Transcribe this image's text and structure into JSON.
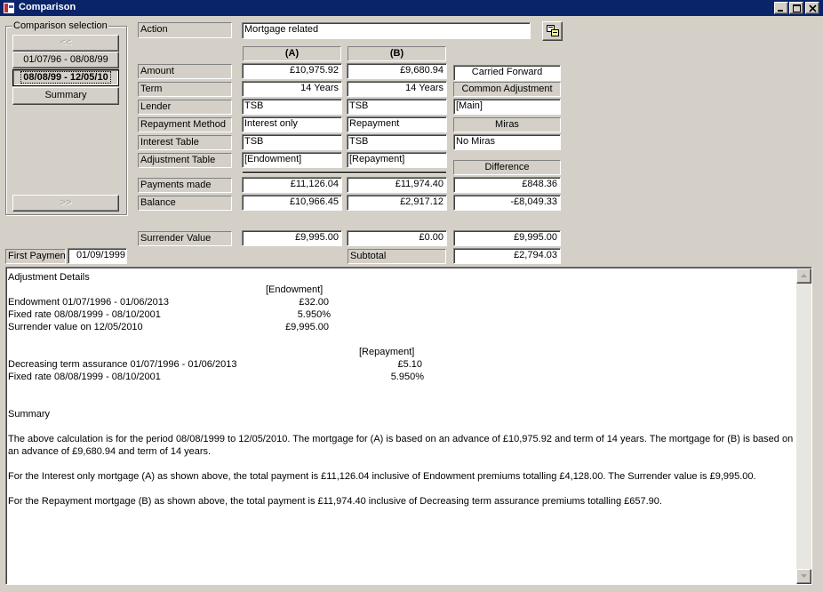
{
  "window": {
    "title": "Comparison"
  },
  "selection": {
    "group_label": "Comparison selection",
    "prev_label": "<<",
    "next_label": ">>",
    "periods": [
      "01/07/96 - 08/08/99",
      "08/08/99 - 12/05/10"
    ],
    "summary_label": "Summary"
  },
  "action": {
    "label": "Action",
    "value": "Mortgage related"
  },
  "columns": {
    "a": "(A)",
    "b": "(B)"
  },
  "rows": [
    {
      "label": "Amount",
      "a": "£10,975.92",
      "b": "£9,680.94"
    },
    {
      "label": "Term",
      "a": "14 Years",
      "b": "14 Years"
    },
    {
      "label": "Lender",
      "a": "TSB",
      "b": "TSB"
    },
    {
      "label": "Repayment Method",
      "a": "Interest only",
      "b": "Repayment"
    },
    {
      "label": "Interest Table",
      "a": "TSB",
      "b": "TSB"
    },
    {
      "label": "Adjustment Table",
      "a": "[Endowment]",
      "b": "[Repayment]"
    }
  ],
  "right_panel": {
    "carried_forward": "Carried Forward",
    "common_adjustment": "Common Adjustment",
    "main_value": "[Main]",
    "miras_label": "Miras",
    "miras_value": "No Miras",
    "difference_label": "Difference"
  },
  "results": [
    {
      "label": "Payments made",
      "a": "£11,126.04",
      "b": "£11,974.40",
      "diff": "£848.36"
    },
    {
      "label": "Balance",
      "a": "£10,966.45",
      "b": "£2,917.12",
      "diff": "-£8,049.33"
    }
  ],
  "surrender": {
    "label": "Surrender Value",
    "a": "£9,995.00",
    "b": "£0.00",
    "diff": "£9,995.00"
  },
  "first_payment": {
    "label": "First Payment",
    "value": "01/09/1999"
  },
  "subtotal": {
    "label": "Subtotal",
    "value": "£2,794.03"
  },
  "details": {
    "heading": "Adjustment Details",
    "endowment_header": "[Endowment]",
    "endowment_rows": [
      {
        "desc": "Endowment 01/07/1996 - 01/06/2013",
        "value": "£32.00"
      },
      {
        "desc": "Fixed rate 08/08/1999 - 08/10/2001",
        "value": "5.950%"
      },
      {
        "desc": "Surrender value on 12/05/2010",
        "value": "£9,995.00"
      }
    ],
    "repayment_header": "[Repayment]",
    "repayment_rows": [
      {
        "desc": "Decreasing term assurance 01/07/1996 - 01/06/2013",
        "value": "£5.10"
      },
      {
        "desc": "Fixed rate 08/08/1999 - 08/10/2001",
        "value": "5.950%"
      }
    ],
    "summary_heading": "Summary",
    "paragraphs": [
      "The above calculation is for the period 08/08/1999 to 12/05/2010. The mortgage for (A) is based on an advance of £10,975.92 and term of 14 years. The mortgage for (B) is based on an advance of £9,680.94 and term of 14 years.",
      "For the Interest only mortgage (A) as shown above, the total payment is £11,126.04 inclusive of Endowment premiums totalling £4,128.00. The Surrender value is £9,995.00.",
      "For the Repayment mortgage (B) as shown above, the total payment is £11,974.40 inclusive of Decreasing term assurance premiums totalling £657.90."
    ]
  },
  "icons": {
    "app": "app-icon",
    "window_controls": [
      "minimize-icon",
      "maximize-icon",
      "close-icon"
    ],
    "compare": "compare-icon",
    "scroll": [
      "scroll-up-icon",
      "scroll-down-icon"
    ]
  },
  "colors": {
    "titlebar": "#0a246a",
    "face": "#d4d0c8"
  }
}
